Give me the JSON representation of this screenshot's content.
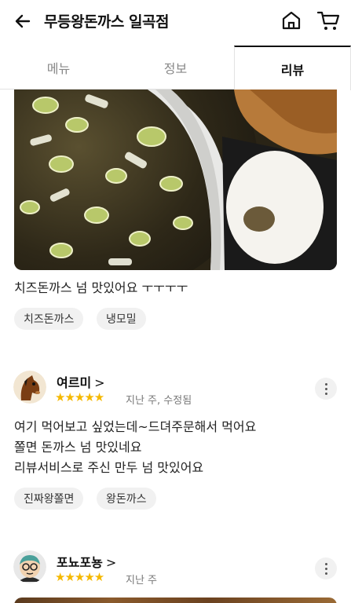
{
  "header": {
    "title": "무등왕돈까스 일곡점",
    "back_icon": "arrow-left-icon",
    "home_icon": "home-icon",
    "cart_icon": "cart-icon"
  },
  "tabs": [
    {
      "label": "메뉴",
      "active": false
    },
    {
      "label": "정보",
      "active": false
    },
    {
      "label": "리뷰",
      "active": true
    }
  ],
  "reviews": [
    {
      "text": "치즈돈까스 넘 맛있어요 ㅜㅜㅜㅜ",
      "tags": [
        "치즈돈까스",
        "냉모밀"
      ]
    },
    {
      "author": "여르미",
      "stars": "★★★★★",
      "meta": "지난 주, 수정됨",
      "lines": [
        "여기 먹어보고 싶었는데~드뎌주문해서 먹어요",
        "쫄면 돈까스 넘 맛있네요",
        "리뷰서비스로 주신 만두 넘 맛있어요"
      ],
      "tags": [
        "진짜왕쫄면",
        "왕돈까스"
      ]
    },
    {
      "author": "포뇨포뇽",
      "stars": "★★★★★",
      "meta": "지난 주"
    }
  ],
  "colors": {
    "star": "#f5b800",
    "chip_bg": "#f1f1f1",
    "muted": "#777777"
  }
}
